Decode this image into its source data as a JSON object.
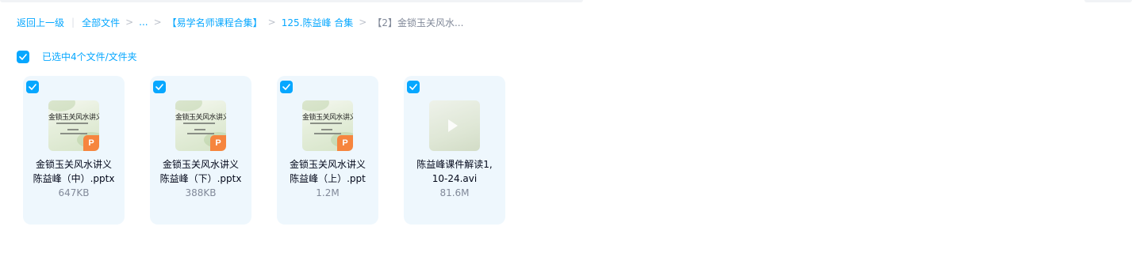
{
  "breadcrumb": {
    "back": "返回上一级",
    "all_files": "全部文件",
    "ellipsis": "...",
    "folder1": "【易学名师课程合集】",
    "folder2": "125.陈益峰 合集",
    "current": "【2】金锁玉关风水..."
  },
  "selection": {
    "label": "已选中4个文件/文件夹"
  },
  "files": [
    {
      "name_line1": "金锁玉关风水讲义",
      "name_line2": "陈益峰（中）.pptx",
      "size": "647KB",
      "type": "ppt",
      "checked": true
    },
    {
      "name_line1": "金锁玉关风水讲义",
      "name_line2": "陈益峰（下）.pptx",
      "size": "388KB",
      "type": "ppt",
      "checked": true
    },
    {
      "name_line1": "金锁玉关风水讲义",
      "name_line2": "陈益峰（上）.ppt",
      "size": "1.2M",
      "type": "ppt",
      "checked": true
    },
    {
      "name_line1": "陈益峰课件解读1,",
      "name_line2": "10-24.avi",
      "size": "81.6M",
      "type": "video",
      "checked": true
    }
  ],
  "thumbnail_text": {
    "ppt_title": "金锁玉关风水讲义",
    "ppt_badge": "P"
  },
  "colors": {
    "accent": "#06a7ff",
    "card_bg": "#eef7fd",
    "ppt_badge": "#f6853e",
    "muted_text": "#818999"
  }
}
